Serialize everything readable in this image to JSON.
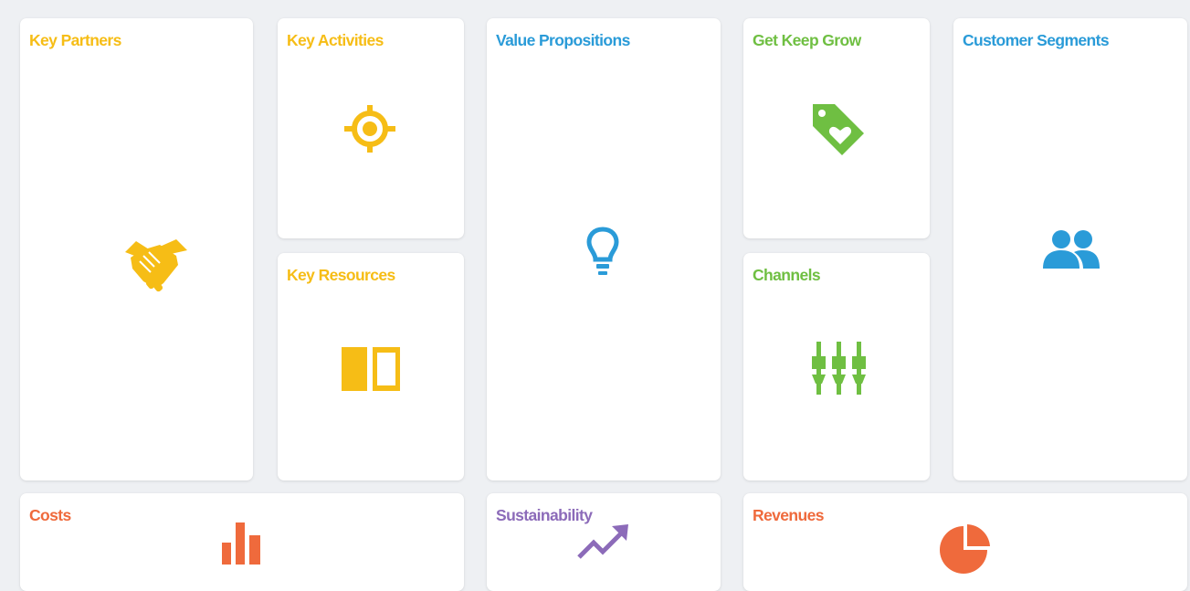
{
  "canvas": {
    "colors": {
      "yellow": "#f6bd16",
      "blue": "#2a9bd8",
      "green": "#6fbf42",
      "orange": "#ef6a3c",
      "purple": "#8c6bb9"
    },
    "blocks": [
      {
        "id": "key_partners",
        "label": "Key Partners",
        "icon": "handshake-icon",
        "color": "#f6bd16"
      },
      {
        "id": "key_activities",
        "label": "Key Activities",
        "icon": "target-icon",
        "color": "#f6bd16"
      },
      {
        "id": "key_resources",
        "label": "Key Resources",
        "icon": "book-icon",
        "color": "#f6bd16"
      },
      {
        "id": "value_propositions",
        "label": "Value Propositions",
        "icon": "lightbulb-icon",
        "color": "#2a9bd8"
      },
      {
        "id": "get_keep_grow",
        "label": "Get Keep Grow",
        "icon": "heart-tag-icon",
        "color": "#6fbf42"
      },
      {
        "id": "channels",
        "label": "Channels",
        "icon": "faders-icon",
        "color": "#6fbf42"
      },
      {
        "id": "customer_segments",
        "label": "Customer Segments",
        "icon": "users-icon",
        "color": "#2a9bd8"
      },
      {
        "id": "costs",
        "label": "Costs",
        "icon": "bar-chart-icon",
        "color": "#ef6a3c"
      },
      {
        "id": "sustainability",
        "label": "Sustainability",
        "icon": "trend-up-icon",
        "color": "#8c6bb9"
      },
      {
        "id": "revenues",
        "label": "Revenues",
        "icon": "pie-chart-icon",
        "color": "#ef6a3c"
      }
    ]
  }
}
